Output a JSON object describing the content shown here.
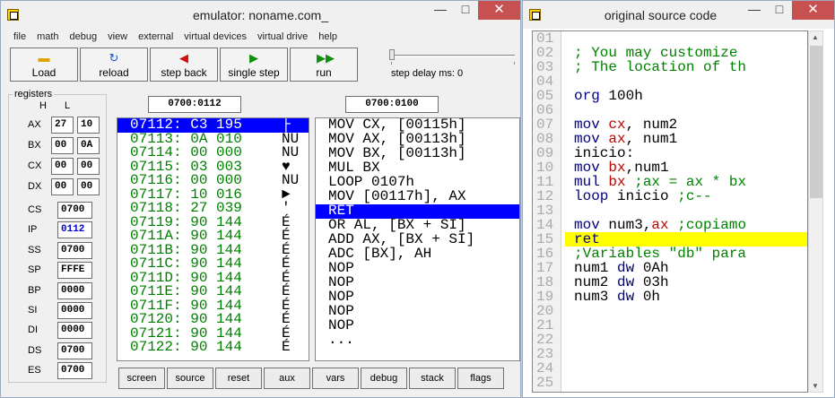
{
  "emu": {
    "title": "emulator: noname.com_",
    "menu": [
      "file",
      "math",
      "debug",
      "view",
      "external",
      "virtual devices",
      "virtual drive",
      "help"
    ],
    "toolbar": [
      {
        "label": "Load",
        "icon": "folder-icon",
        "color": "#d9a400"
      },
      {
        "label": "reload",
        "icon": "reload-icon",
        "color": "#1a4fd0"
      },
      {
        "label": "step back",
        "icon": "step-back-icon",
        "color": "#d01010"
      },
      {
        "label": "single step",
        "icon": "single-step-icon",
        "color": "#109010"
      },
      {
        "label": "run",
        "icon": "run-icon",
        "color": "#109010"
      }
    ],
    "step_delay_label": "step delay ms: 0",
    "registers": {
      "title": "registers",
      "h": "H",
      "l": "L",
      "gp": [
        {
          "name": "AX",
          "h": "27",
          "l": "10"
        },
        {
          "name": "BX",
          "h": "00",
          "l": "0A"
        },
        {
          "name": "CX",
          "h": "00",
          "l": "00"
        },
        {
          "name": "DX",
          "h": "00",
          "l": "00"
        }
      ],
      "seg": [
        {
          "name": "CS",
          "value": "0700",
          "blue": false
        },
        {
          "name": "IP",
          "value": "0112",
          "blue": true
        },
        {
          "name": "SS",
          "value": "0700",
          "blue": false
        },
        {
          "name": "SP",
          "value": "FFFE",
          "blue": false
        },
        {
          "name": "BP",
          "value": "0000",
          "blue": false
        },
        {
          "name": "SI",
          "value": "0000",
          "blue": false
        },
        {
          "name": "DI",
          "value": "0000",
          "blue": false
        },
        {
          "name": "DS",
          "value": "0700",
          "blue": false
        },
        {
          "name": "ES",
          "value": "0700",
          "blue": false
        }
      ]
    },
    "mem_addr": "0700:0112",
    "dis_addr": "0700:0100",
    "memory": [
      {
        "addr": "07112:",
        "hex": "C3",
        "dec": "195",
        "ch": "├",
        "sel": true
      },
      {
        "addr": "07113:",
        "hex": "0A",
        "dec": "010",
        "ch": "NU",
        "sel": false
      },
      {
        "addr": "07114:",
        "hex": "00",
        "dec": "000",
        "ch": "NU",
        "sel": false
      },
      {
        "addr": "07115:",
        "hex": "03",
        "dec": "003",
        "ch": "♥",
        "sel": false
      },
      {
        "addr": "07116:",
        "hex": "00",
        "dec": "000",
        "ch": "NU",
        "sel": false
      },
      {
        "addr": "07117:",
        "hex": "10",
        "dec": "016",
        "ch": "►",
        "sel": false
      },
      {
        "addr": "07118:",
        "hex": "27",
        "dec": "039",
        "ch": "'",
        "sel": false
      },
      {
        "addr": "07119:",
        "hex": "90",
        "dec": "144",
        "ch": "É",
        "sel": false
      },
      {
        "addr": "0711A:",
        "hex": "90",
        "dec": "144",
        "ch": "É",
        "sel": false
      },
      {
        "addr": "0711B:",
        "hex": "90",
        "dec": "144",
        "ch": "É",
        "sel": false
      },
      {
        "addr": "0711C:",
        "hex": "90",
        "dec": "144",
        "ch": "É",
        "sel": false
      },
      {
        "addr": "0711D:",
        "hex": "90",
        "dec": "144",
        "ch": "É",
        "sel": false
      },
      {
        "addr": "0711E:",
        "hex": "90",
        "dec": "144",
        "ch": "É",
        "sel": false
      },
      {
        "addr": "0711F:",
        "hex": "90",
        "dec": "144",
        "ch": "É",
        "sel": false
      },
      {
        "addr": "07120:",
        "hex": "90",
        "dec": "144",
        "ch": "É",
        "sel": false
      },
      {
        "addr": "07121:",
        "hex": "90",
        "dec": "144",
        "ch": "É",
        "sel": false
      },
      {
        "addr": "07122:",
        "hex": "90",
        "dec": "144",
        "ch": "É",
        "sel": false
      }
    ],
    "disasm": [
      {
        "text": "MOV CX, [00115h]",
        "sel": false
      },
      {
        "text": "MOV AX, [00113h]",
        "sel": false
      },
      {
        "text": "MOV BX, [00113h]",
        "sel": false
      },
      {
        "text": "MUL BX",
        "sel": false
      },
      {
        "text": "LOOP 0107h",
        "sel": false
      },
      {
        "text": "MOV [00117h], AX",
        "sel": false
      },
      {
        "text": "RET",
        "sel": true
      },
      {
        "text": "OR AL, [BX + SI]",
        "sel": false
      },
      {
        "text": "ADD AX, [BX + SI]",
        "sel": false
      },
      {
        "text": "ADC [BX], AH",
        "sel": false
      },
      {
        "text": "NOP",
        "sel": false
      },
      {
        "text": "NOP",
        "sel": false
      },
      {
        "text": "NOP",
        "sel": false
      },
      {
        "text": "NOP",
        "sel": false
      },
      {
        "text": "NOP",
        "sel": false
      },
      {
        "text": "...",
        "sel": false
      }
    ],
    "bottom": [
      "screen",
      "source",
      "reset",
      "aux",
      "vars",
      "debug",
      "stack",
      "flags"
    ]
  },
  "src": {
    "title": "original source code",
    "lines": [
      {
        "n": "01",
        "parts": []
      },
      {
        "n": "02",
        "parts": [
          {
            "t": "; You may customize ",
            "c": "cmt"
          }
        ]
      },
      {
        "n": "03",
        "parts": [
          {
            "t": "; The location of th",
            "c": "cmt"
          }
        ]
      },
      {
        "n": "04",
        "parts": []
      },
      {
        "n": "05",
        "parts": [
          {
            "t": "org",
            "c": "kw"
          },
          {
            "t": " 100h",
            "c": ""
          }
        ]
      },
      {
        "n": "06",
        "parts": []
      },
      {
        "n": "07",
        "parts": [
          {
            "t": "mov",
            "c": "kw"
          },
          {
            "t": " ",
            "c": ""
          },
          {
            "t": "cx",
            "c": "reg"
          },
          {
            "t": ", num2",
            "c": ""
          }
        ]
      },
      {
        "n": "08",
        "parts": [
          {
            "t": "mov",
            "c": "kw"
          },
          {
            "t": " ",
            "c": ""
          },
          {
            "t": "ax",
            "c": "reg"
          },
          {
            "t": ", num1",
            "c": ""
          }
        ]
      },
      {
        "n": "09",
        "parts": [
          {
            "t": "inicio:",
            "c": ""
          }
        ]
      },
      {
        "n": "10",
        "parts": [
          {
            "t": "mov",
            "c": "kw"
          },
          {
            "t": " ",
            "c": ""
          },
          {
            "t": "bx",
            "c": "reg"
          },
          {
            "t": ",num1",
            "c": ""
          }
        ]
      },
      {
        "n": "11",
        "parts": [
          {
            "t": "mul",
            "c": "kw"
          },
          {
            "t": " ",
            "c": ""
          },
          {
            "t": "bx",
            "c": "reg"
          },
          {
            "t": " ;ax = ax * bx",
            "c": "cmt"
          }
        ]
      },
      {
        "n": "12",
        "parts": [
          {
            "t": "loop",
            "c": "kw"
          },
          {
            "t": " inicio ",
            "c": ""
          },
          {
            "t": ";c--",
            "c": "cmt"
          }
        ]
      },
      {
        "n": "13",
        "parts": []
      },
      {
        "n": "14",
        "parts": [
          {
            "t": "mov",
            "c": "kw"
          },
          {
            "t": " num3,",
            "c": ""
          },
          {
            "t": "ax",
            "c": "reg"
          },
          {
            "t": " ;copiamo",
            "c": "cmt"
          }
        ]
      },
      {
        "n": "15",
        "parts": [
          {
            "t": "ret",
            "c": "kw"
          }
        ],
        "hi": true
      },
      {
        "n": "16",
        "parts": [
          {
            "t": ";Variables \"db\" para",
            "c": "cmt"
          }
        ]
      },
      {
        "n": "17",
        "parts": [
          {
            "t": "num1 ",
            "c": ""
          },
          {
            "t": "dw",
            "c": "kw"
          },
          {
            "t": " 0Ah",
            "c": ""
          }
        ]
      },
      {
        "n": "18",
        "parts": [
          {
            "t": "num2 ",
            "c": ""
          },
          {
            "t": "dw",
            "c": "kw"
          },
          {
            "t": " 03h",
            "c": ""
          }
        ]
      },
      {
        "n": "19",
        "parts": [
          {
            "t": "num3 ",
            "c": ""
          },
          {
            "t": "dw",
            "c": "kw"
          },
          {
            "t": " 0h",
            "c": ""
          }
        ]
      },
      {
        "n": "20",
        "parts": []
      },
      {
        "n": "21",
        "parts": []
      },
      {
        "n": "22",
        "parts": []
      },
      {
        "n": "23",
        "parts": []
      },
      {
        "n": "24",
        "parts": []
      },
      {
        "n": "25",
        "parts": []
      }
    ]
  }
}
